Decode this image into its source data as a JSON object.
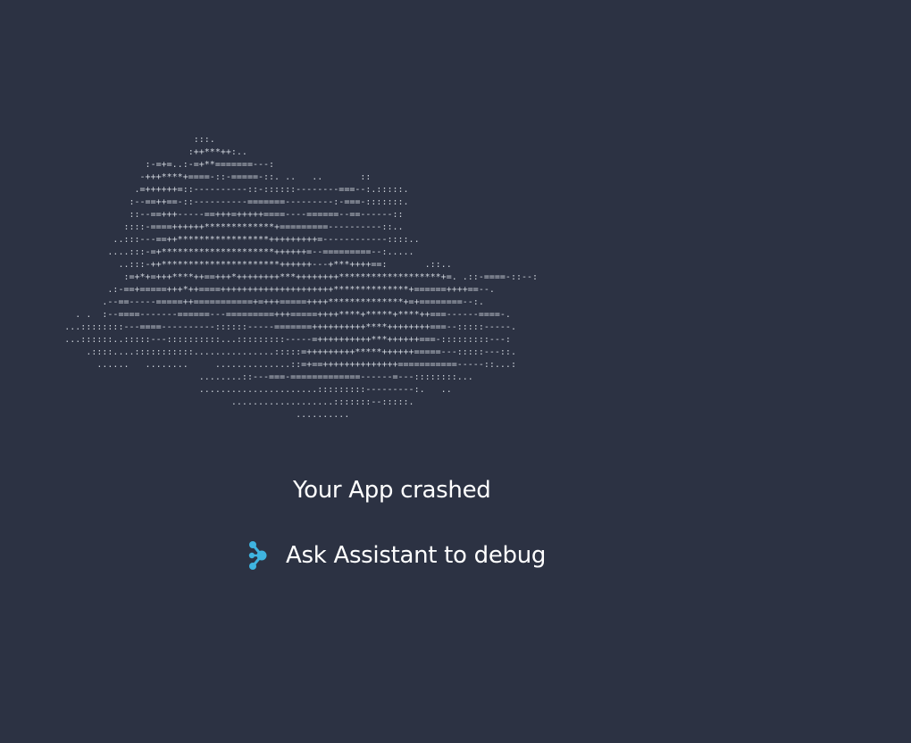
{
  "ascii_art": {
    "lines": [
      "                                    :::.",
      "                                   :++***++:..",
      "                           :-=+=..:-=+**=======---:",
      "                          -+++****+====-::-=====-::. ..   ..       ::",
      "                         .=++++++=::----------::-::::::--------===--:.:::::.",
      "                        :--==++==-::----------=======---------:-===-:::::::.",
      "                        ::--==+++-----==+++=+++++====----======--==------::",
      "                       ::::-====++++++*************+=========----------::..",
      "                     ..:::---==++*****************+++++++++=------------::::..",
      "                    ....:::-=+*********************++++++=--=========--:.....",
      "                      ..:::-++**********************++++++---+***++++==:       .::..",
      "                       :=+*+=+++****++==+++*++++++++***++++++++*******************+=. .::-====-::--:",
      "                    .:-==+=====+++*++====+++++++++++++++++++++**************+======++++==--.",
      "                   .--==-----=====++===========+=+++=====++++**************+=+========--:.",
      "              . .  :--====-------======---=========+++=====++++****+*****+****++===------====-.",
      "            ...::::::::---====----------::::::-----=======++++++++++****++++++++===--:::::-----.",
      "            ...::::::..:::::---::::::::::...:::::::::-----=++++++++++***++++++===-:::::::::---:",
      "                .::::....:::::::::::...............:::::=+++++++++*****++++++=====---:::::---::.",
      "                  ......   ........     ..............::=+==++++++++++++++===========-----::...:",
      "                                     ........::---===-=============------=---::::::::...",
      "                                     ......................:::::::::---------:.   ..",
      "                                           ...................:::::::--:::::.",
      "                                                       .........."
    ]
  },
  "crash_title": "Your App crashed",
  "debug_action": {
    "label": "Ask Assistant to debug",
    "icon": "assistant-icon",
    "icon_color": "#3fb4e0"
  },
  "colors": {
    "background": "#2c3243",
    "ascii": "#cfd4dc",
    "text": "#ffffff"
  }
}
